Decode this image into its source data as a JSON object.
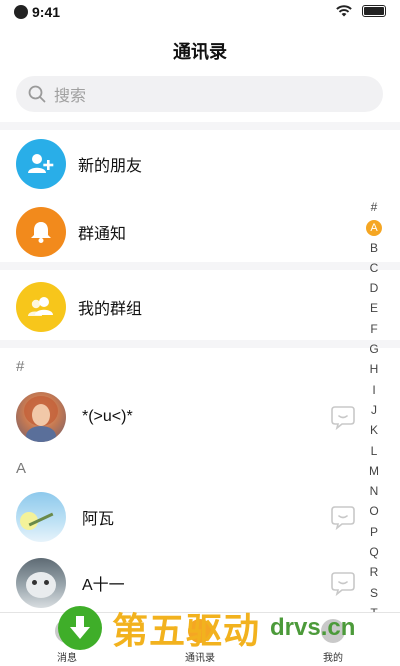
{
  "status": {
    "time": "9:41"
  },
  "title": "通讯录",
  "search": {
    "placeholder": "搜索"
  },
  "entries": [
    {
      "label": "新的朋友",
      "icon": "add-friend-icon",
      "color": "#29aee8"
    },
    {
      "label": "群通知",
      "icon": "bell-icon",
      "color": "#f28a1c"
    },
    {
      "label": "我的群组",
      "icon": "group-icon",
      "color": "#f7c61b"
    }
  ],
  "sections": [
    {
      "letter": "#",
      "contacts": [
        {
          "name": "*(>u<)*",
          "avatar": "portrait-avatar"
        }
      ]
    },
    {
      "letter": "A",
      "contacts": [
        {
          "name": "阿瓦",
          "avatar": "sky-avatar"
        },
        {
          "name": "A十一",
          "avatar": "cat-avatar"
        }
      ]
    }
  ],
  "index": [
    "#",
    "A",
    "B",
    "C",
    "D",
    "E",
    "F",
    "G",
    "H",
    "I",
    "J",
    "K",
    "L",
    "M",
    "N",
    "O",
    "P",
    "Q",
    "R",
    "S",
    "T"
  ],
  "index_active": "A",
  "tabs": [
    {
      "label": "消息"
    },
    {
      "label": "通讯录"
    },
    {
      "label": "我的"
    }
  ],
  "watermark": {
    "brand": "第五驱动",
    "site": "drvs.cn"
  },
  "colors": {
    "accent": "#f5a623",
    "band": "#f5f5f7"
  }
}
